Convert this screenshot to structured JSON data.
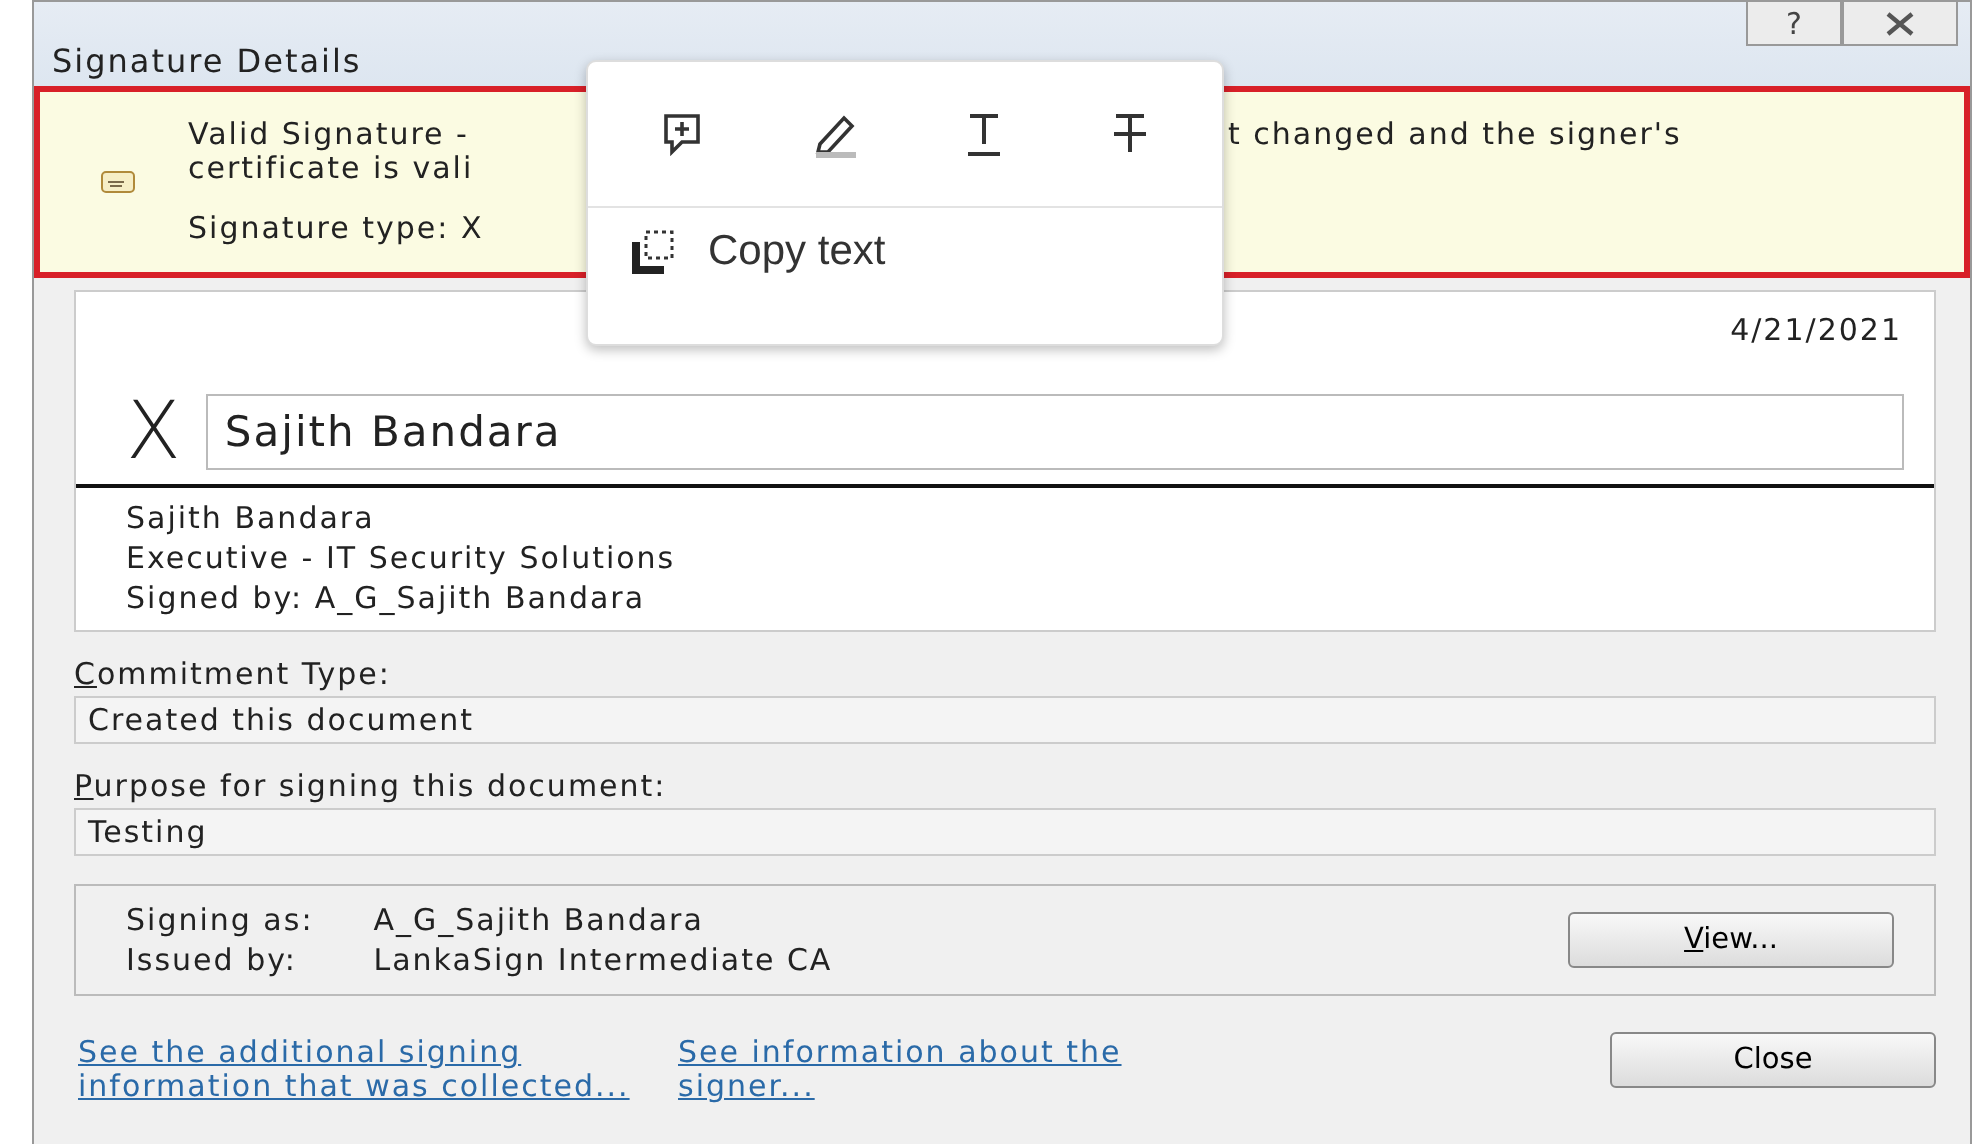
{
  "window": {
    "title": "Signature Details",
    "help": "?"
  },
  "banner": {
    "line1_left": "Valid Signature -",
    "line1_right": "t changed and the signer's",
    "line2": "certificate is vali",
    "line3": "Signature type: X"
  },
  "popup": {
    "copy_label": "Copy text"
  },
  "signature": {
    "date": "4/21/2021",
    "mark": "X",
    "name_field": "Sajith Bandara",
    "lines": [
      "Sajith Bandara",
      "Executive - IT Security Solutions",
      "Signed by: A_G_Sajith Bandara"
    ]
  },
  "commitment": {
    "label": "Commitment Type:",
    "value": "Created this document"
  },
  "purpose": {
    "label": "Purpose for signing this document:",
    "value": "Testing"
  },
  "signer": {
    "rows": [
      {
        "label": "Signing as:",
        "value": "A_G_Sajith Bandara"
      },
      {
        "label": "Issued by:",
        "value": "LankaSign Intermediate CA"
      }
    ],
    "view_button": "View..."
  },
  "links": [
    "See the additional signing information that was collected...",
    "See information about the signer..."
  ],
  "close_button": "Close"
}
